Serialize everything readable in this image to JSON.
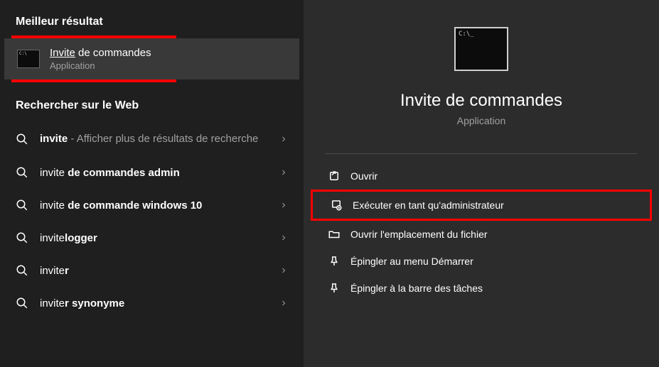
{
  "left": {
    "best_header": "Meilleur résultat",
    "best_match": {
      "title_underlined": "Invite",
      "title_rest": " de commandes",
      "subtitle": "Application"
    },
    "web_header": "Rechercher sur le Web",
    "items": [
      {
        "bold": "invite",
        "muted": " - Afficher plus de résultats de recherche"
      },
      {
        "plain": "invite ",
        "bold": "de commandes admin"
      },
      {
        "plain": "invite ",
        "bold": "de commande windows 10"
      },
      {
        "plain": "invite",
        "bold": "logger"
      },
      {
        "plain": "invite",
        "bold": "r"
      },
      {
        "plain": "invite",
        "bold": "r synonyme"
      }
    ]
  },
  "right": {
    "title": "Invite de commandes",
    "subtitle": "Application",
    "actions": [
      {
        "label": "Ouvrir",
        "icon": "open"
      },
      {
        "label": "Exécuter en tant qu'administrateur",
        "icon": "admin",
        "highlight": true
      },
      {
        "label": "Ouvrir l'emplacement du fichier",
        "icon": "folder"
      },
      {
        "label": "Épingler au menu Démarrer",
        "icon": "pin-start"
      },
      {
        "label": "Épingler à la barre des tâches",
        "icon": "pin-taskbar"
      }
    ]
  }
}
